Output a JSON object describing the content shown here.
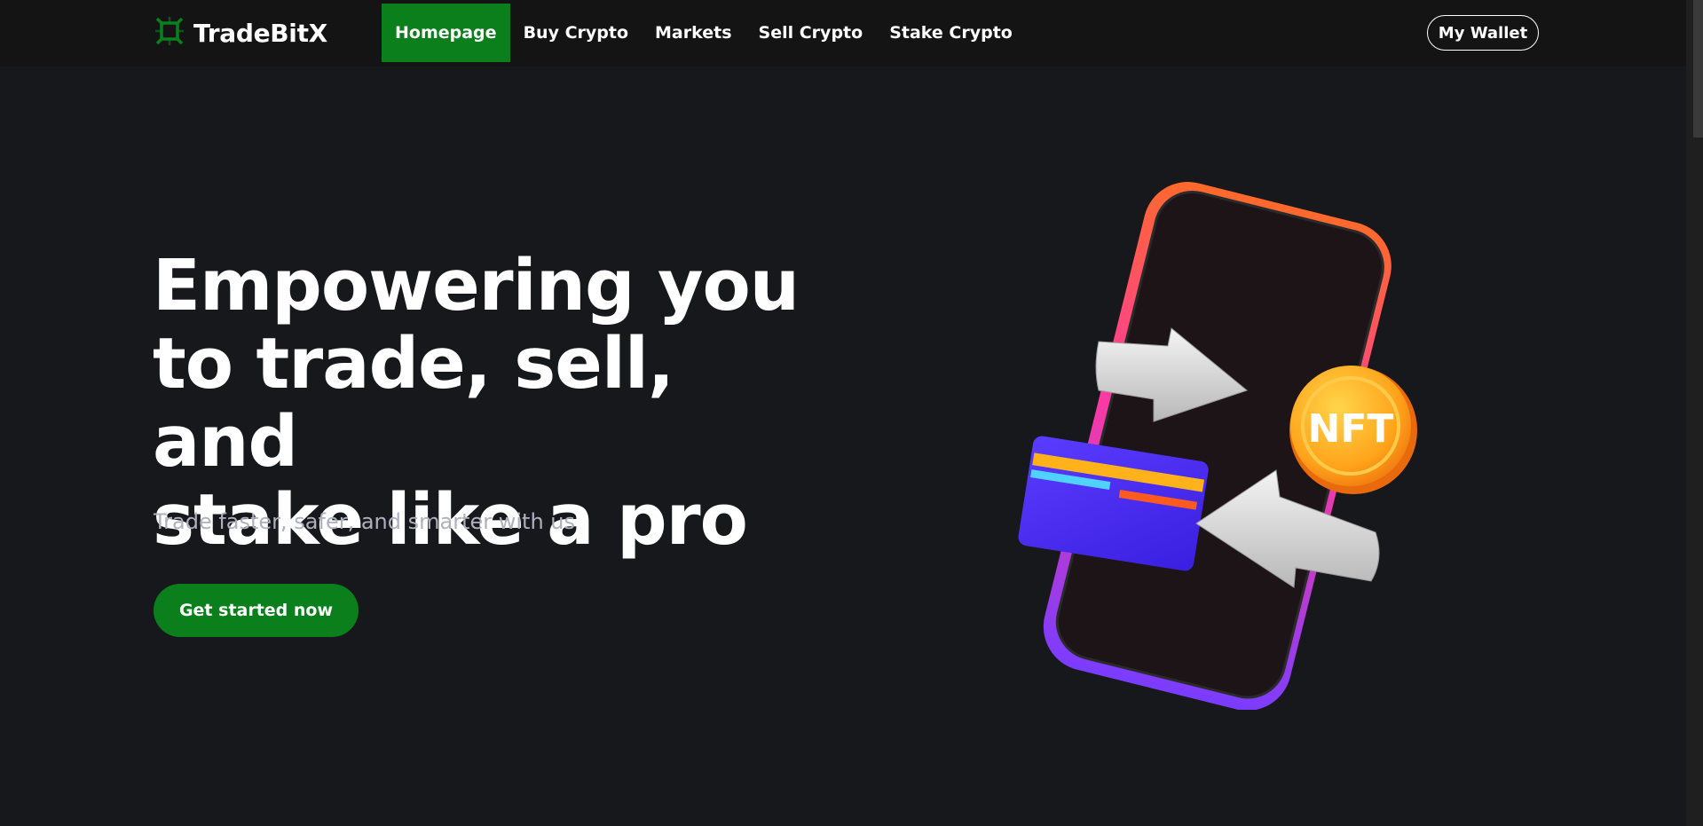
{
  "brand": {
    "name": "TradeBitX",
    "logo_icon": "chip-logo-icon",
    "accent": "#0b7f1c"
  },
  "nav": {
    "items": [
      {
        "label": "Homepage",
        "active": true
      },
      {
        "label": "Buy Crypto",
        "active": false
      },
      {
        "label": "Markets",
        "active": false
      },
      {
        "label": "Sell Crypto",
        "active": false
      },
      {
        "label": "Stake Crypto",
        "active": false
      }
    ],
    "wallet_label": "My Wallet"
  },
  "hero": {
    "title_lines": [
      "Empowering you",
      "to trade, sell, and",
      "stake like a pro"
    ],
    "subtitle": "Trade faster, safer, and smarter with us",
    "cta_label": "Get started now",
    "illustration": {
      "coin_label": "NFT"
    }
  },
  "colors": {
    "background": "#17181c",
    "navbar": "#141414",
    "accent": "#0b7f1c",
    "subtitle": "#aeb1bd"
  }
}
